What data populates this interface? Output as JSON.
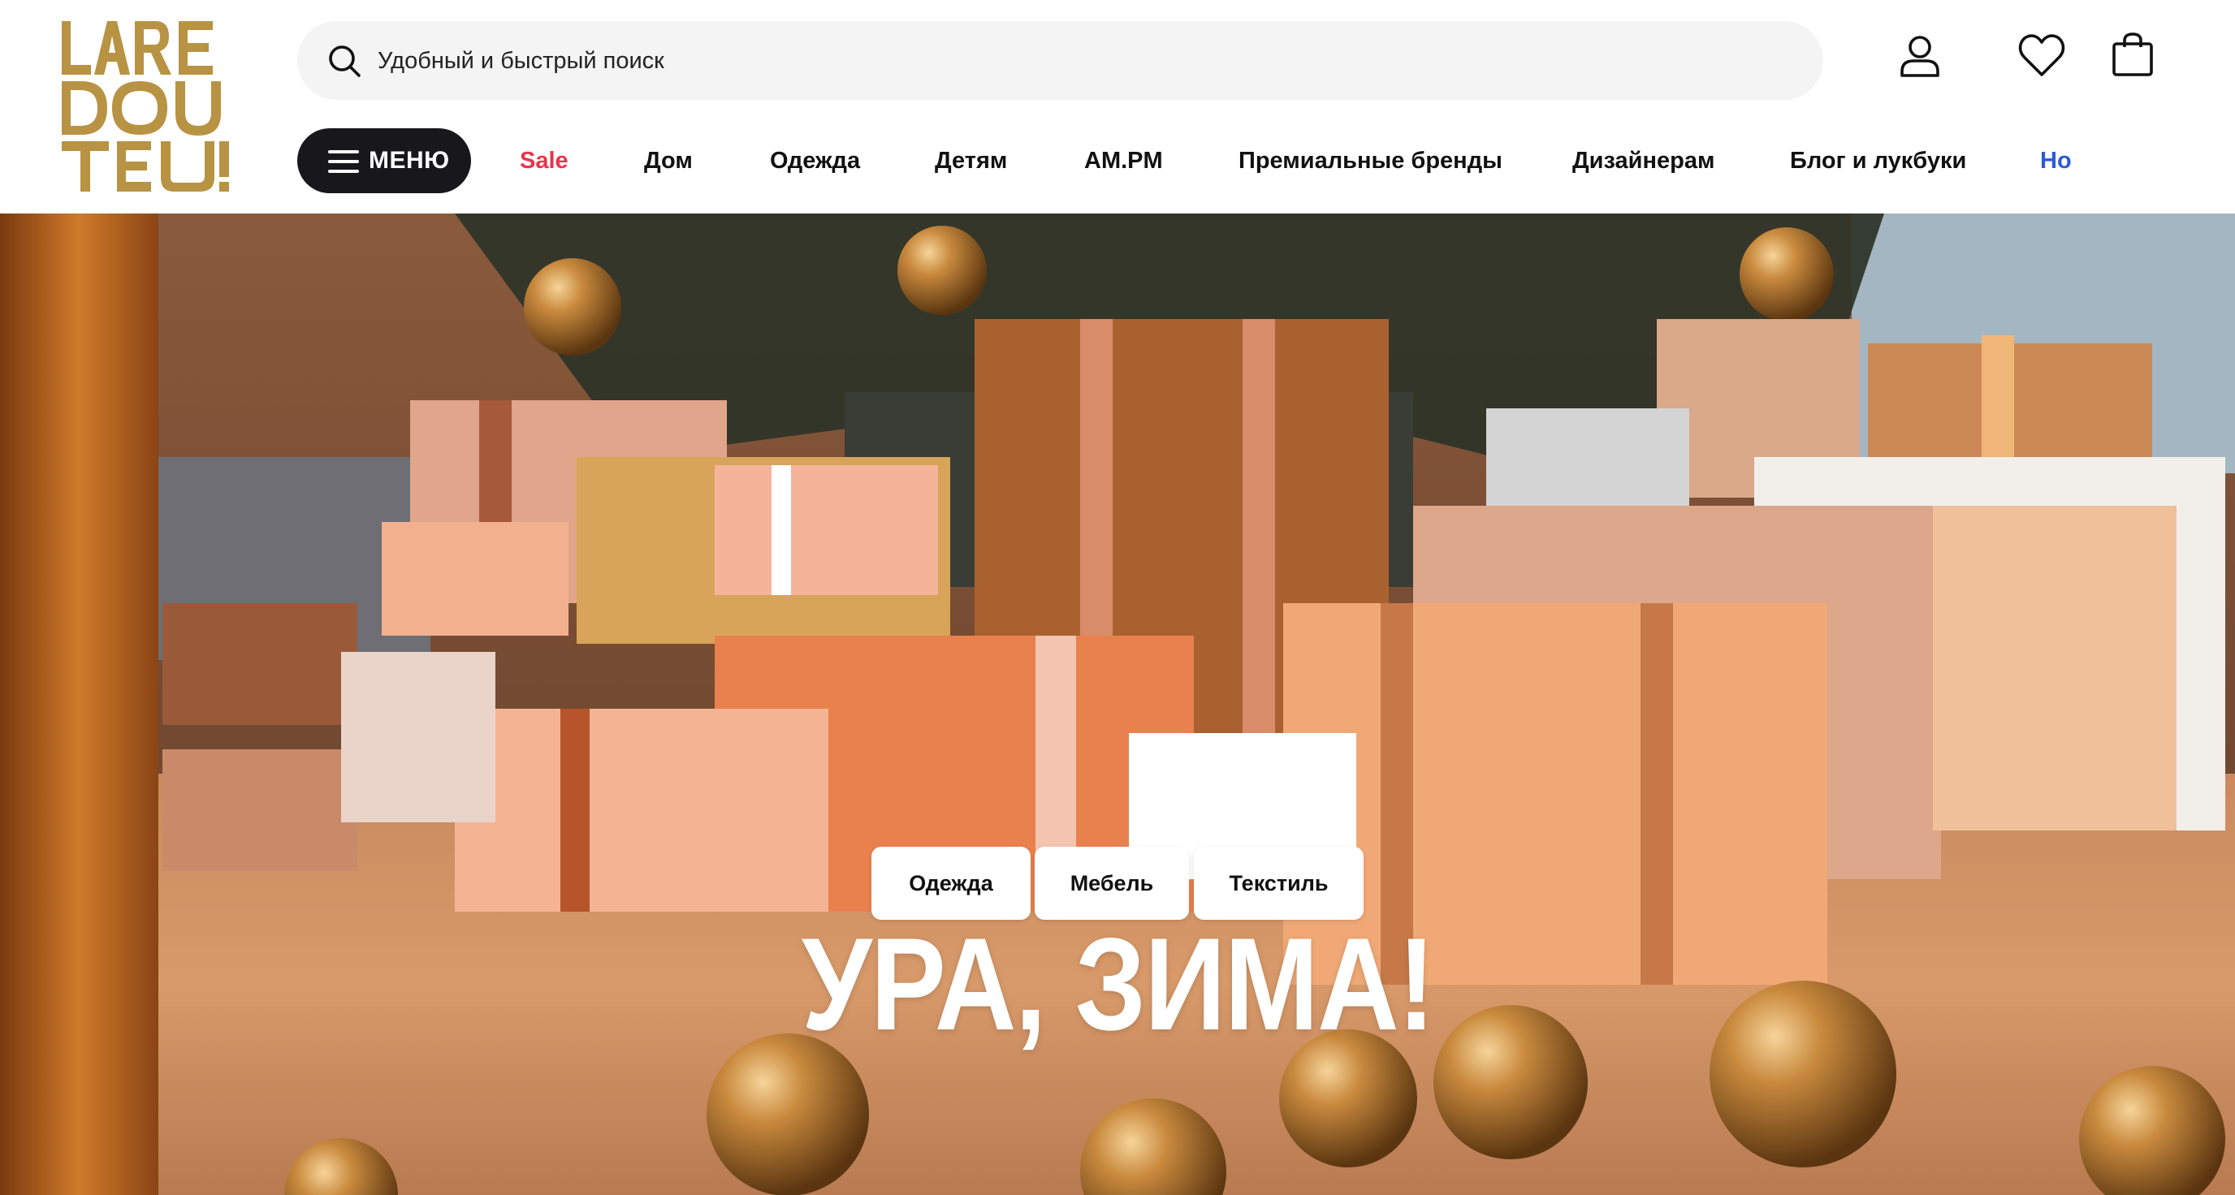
{
  "brand": {
    "logo_text": "LAREDOUTE",
    "logo_color": "#b89343"
  },
  "search": {
    "placeholder": "Удобный и быстрый поиск",
    "icon": "search-icon"
  },
  "header_icons": [
    "account-icon",
    "heart-icon",
    "shopping-bag-icon"
  ],
  "menu_button": {
    "label": "МЕНЮ",
    "icon": "hamburger-icon"
  },
  "nav": {
    "items": [
      {
        "label": "Sale",
        "color": "#e8334a"
      },
      {
        "label": "Дом"
      },
      {
        "label": "Одежда"
      },
      {
        "label": "Детям"
      },
      {
        "label": "AM.PM"
      },
      {
        "label": "Премиальные бренды"
      },
      {
        "label": "Дизайнерам"
      },
      {
        "label": "Блог и лукбуки"
      },
      {
        "label": "Но",
        "color": "#2a5bd7"
      }
    ]
  },
  "hero": {
    "headline": "УРА, ЗИМА!",
    "buttons": [
      {
        "label": "Одежда"
      },
      {
        "label": "Мебель"
      },
      {
        "label": "Текстиль"
      }
    ]
  }
}
